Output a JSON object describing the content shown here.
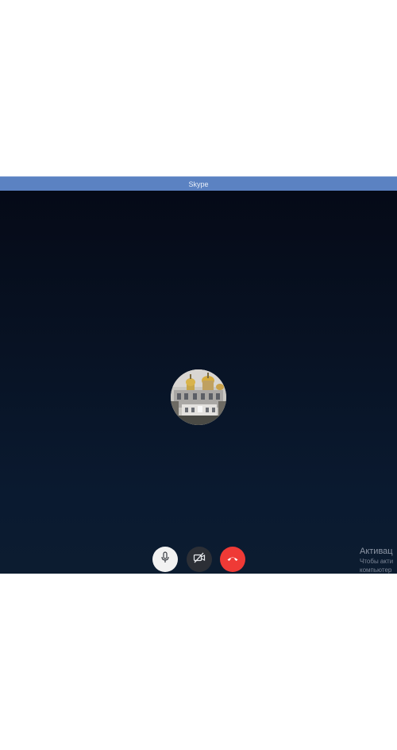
{
  "window": {
    "title": "Skype"
  },
  "call": {
    "avatar_icon": "contact-avatar-cathedral-photo",
    "background_top": "#050a17",
    "background_bottom": "#0c1c30"
  },
  "controls": {
    "mic_icon": "microphone-icon",
    "camera_icon": "video-off-icon",
    "hangup_icon": "hang-up-icon",
    "hangup_color": "#ef3a36"
  },
  "activation_notice": {
    "title": "Активац",
    "line1": "Чтобы акти",
    "line2": "компьютер"
  }
}
